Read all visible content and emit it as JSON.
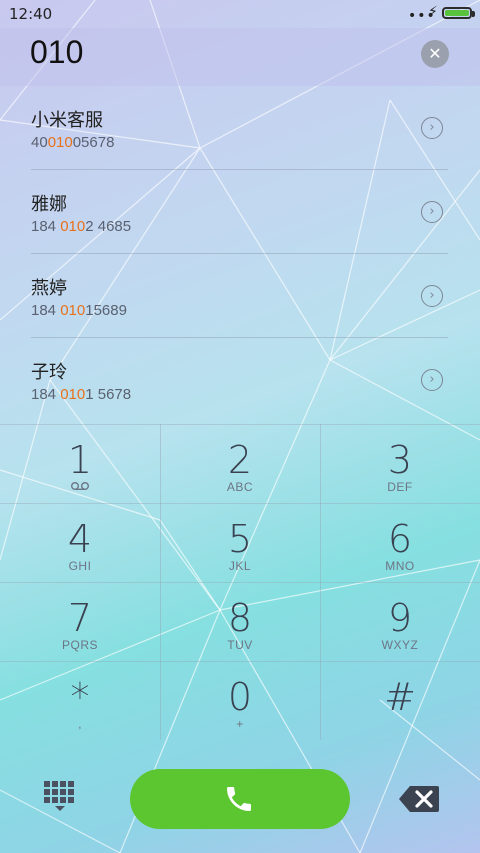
{
  "status_bar": {
    "time": "12:40",
    "signal_dots": "•••",
    "charging_icon": "⚡",
    "battery_color": "#59c23c"
  },
  "dial_input": {
    "value": "010",
    "clear_icon": "clear-icon"
  },
  "results": [
    {
      "name": "小米客服",
      "number_pre": "40",
      "number_match": "010",
      "number_post": "05678"
    },
    {
      "name": "雅娜",
      "number_pre": "184 ",
      "number_match": "010",
      "number_post": "2 4685"
    },
    {
      "name": "燕婷",
      "number_pre": "184 ",
      "number_match": "010",
      "number_post": "15689"
    },
    {
      "name": "子玲",
      "number_pre": "184 ",
      "number_match": "010",
      "number_post": "1 5678"
    }
  ],
  "keypad": {
    "k1": {
      "digit": "1",
      "sub": "voicemail-icon"
    },
    "k2": {
      "digit": "2",
      "sub": "ABC"
    },
    "k3": {
      "digit": "3",
      "sub": "DEF"
    },
    "k4": {
      "digit": "4",
      "sub": "GHI"
    },
    "k5": {
      "digit": "5",
      "sub": "JKL"
    },
    "k6": {
      "digit": "6",
      "sub": "MNO"
    },
    "k7": {
      "digit": "7",
      "sub": "PQRS"
    },
    "k8": {
      "digit": "8",
      "sub": "TUV"
    },
    "k9": {
      "digit": "9",
      "sub": "WXYZ"
    },
    "kstar": {
      "digit": "*",
      "sub": ","
    },
    "k0": {
      "digit": "0",
      "sub": "+"
    },
    "khash": {
      "digit": "#",
      "sub": ""
    }
  },
  "actions": {
    "call_color": "#5cc630",
    "dialpad_icon": "dialpad-icon",
    "call_icon": "phone-icon",
    "backspace_icon": "backspace-icon"
  }
}
